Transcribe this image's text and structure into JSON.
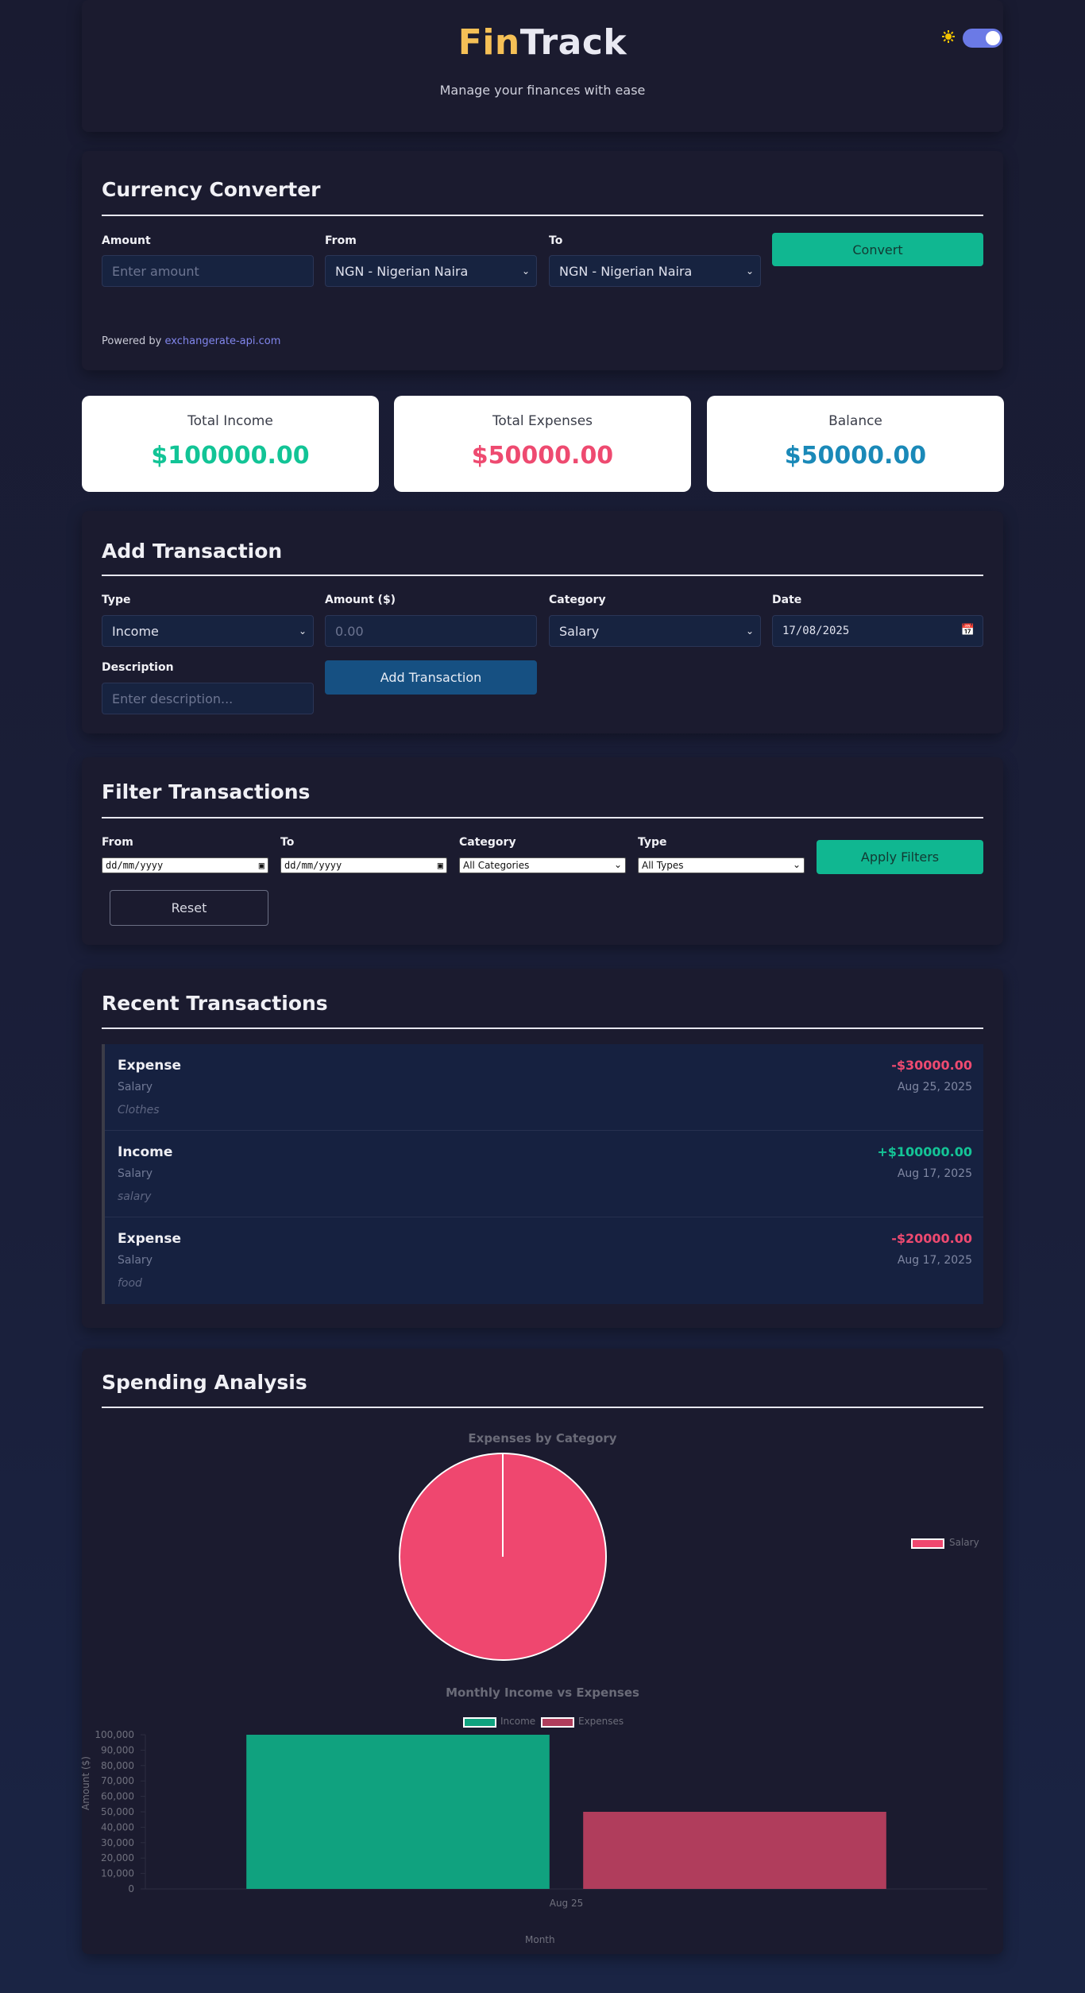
{
  "header": {
    "logo_part1": "Fin",
    "logo_part2": "Track",
    "tagline": "Manage your finances with ease",
    "theme_icon": "sun-icon"
  },
  "converter": {
    "title": "Currency Converter",
    "amount_label": "Amount",
    "amount_placeholder": "Enter amount",
    "from_label": "From",
    "from_value": "NGN - Nigerian Naira",
    "to_label": "To",
    "to_value": "NGN - Nigerian Naira",
    "convert_button": "Convert",
    "powered_prefix": "Powered by",
    "powered_link": "exchangerate-api.com"
  },
  "summary": {
    "income_label": "Total Income",
    "income_value": "$100000.00",
    "expenses_label": "Total Expenses",
    "expenses_value": "$50000.00",
    "balance_label": "Balance",
    "balance_value": "$50000.00"
  },
  "add_transaction": {
    "title": "Add Transaction",
    "type_label": "Type",
    "type_value": "Income",
    "amount_label": "Amount ($)",
    "amount_placeholder": "0.00",
    "category_label": "Category",
    "category_value": "Salary",
    "date_label": "Date",
    "date_value": "17/08/2025",
    "description_label": "Description",
    "description_placeholder": "Enter description...",
    "add_button": "Add Transaction"
  },
  "filter": {
    "title": "Filter Transactions",
    "from_label": "From",
    "from_value": "dd/mm/yyyy",
    "to_label": "To",
    "to_value": "dd/mm/yyyy",
    "category_label": "Category",
    "category_value": "All Categories",
    "type_label": "Type",
    "type_value": "All Types",
    "apply_button": "Apply Filters",
    "reset_button": "Reset"
  },
  "recent": {
    "title": "Recent Transactions",
    "items": [
      {
        "type": "Expense",
        "category": "Salary",
        "description": "Clothes",
        "amount": "-$30000.00",
        "date": "Aug 25, 2025",
        "color": "#ee4a70"
      },
      {
        "type": "Income",
        "category": "Salary",
        "description": "salary",
        "amount": "+$100000.00",
        "date": "Aug 17, 2025",
        "color": "#14c496"
      },
      {
        "type": "Expense",
        "category": "Salary",
        "description": "food",
        "amount": "-$20000.00",
        "date": "Aug 17, 2025",
        "color": "#ee4a70"
      }
    ]
  },
  "analysis": {
    "title": "Spending Analysis"
  },
  "chart_data": [
    {
      "type": "pie",
      "title": "Expenses by Category",
      "labels": [
        "Salary"
      ],
      "values": [
        50000
      ],
      "colors": [
        "#ef476f"
      ],
      "legend": "right"
    },
    {
      "type": "bar",
      "title": "Monthly Income vs Expenses",
      "categories": [
        "Aug 25"
      ],
      "series": [
        {
          "name": "Income",
          "values": [
            100000
          ],
          "color": "#10a27f"
        },
        {
          "name": "Expenses",
          "values": [
            50000
          ],
          "color": "#b03d5c"
        }
      ],
      "xlabel": "Month",
      "ylabel": "Amount ($)",
      "ylim": [
        0,
        100000
      ],
      "yticks": [
        "100,000",
        "90,000",
        "80,000",
        "70,000",
        "60,000",
        "50,000",
        "40,000",
        "30,000",
        "20,000",
        "10,000",
        "0"
      ],
      "legend": "top"
    }
  ]
}
